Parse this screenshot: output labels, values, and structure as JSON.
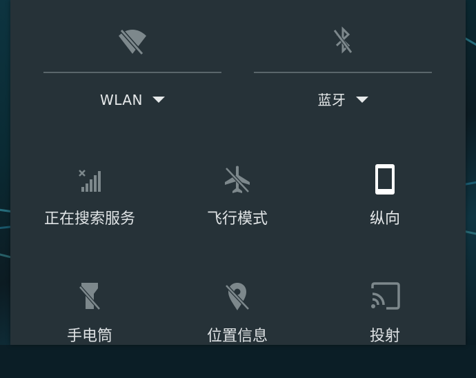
{
  "panel": {
    "background": "#263238",
    "top_tiles": [
      {
        "label": "WLAN",
        "icon": "wifi-off-icon",
        "state": "off"
      },
      {
        "label": "蓝牙",
        "icon": "bluetooth-off-icon",
        "state": "off"
      }
    ],
    "tiles": [
      {
        "label": "正在搜索服务",
        "icon": "cellular-signal-searching-icon",
        "state": "off"
      },
      {
        "label": "飞行模式",
        "icon": "airplane-mode-icon",
        "state": "off"
      },
      {
        "label": "纵向",
        "icon": "portrait-phone-icon",
        "state": "on"
      },
      {
        "label": "手电筒",
        "icon": "flashlight-off-icon",
        "state": "off"
      },
      {
        "label": "位置信息",
        "icon": "location-off-icon",
        "state": "off"
      },
      {
        "label": "投射",
        "icon": "cast-icon",
        "state": "off"
      }
    ]
  },
  "colors": {
    "icon_off": "#7d888c",
    "icon_on": "#ffffff",
    "text": "#e6e9ea",
    "divider": "#5a666b"
  }
}
